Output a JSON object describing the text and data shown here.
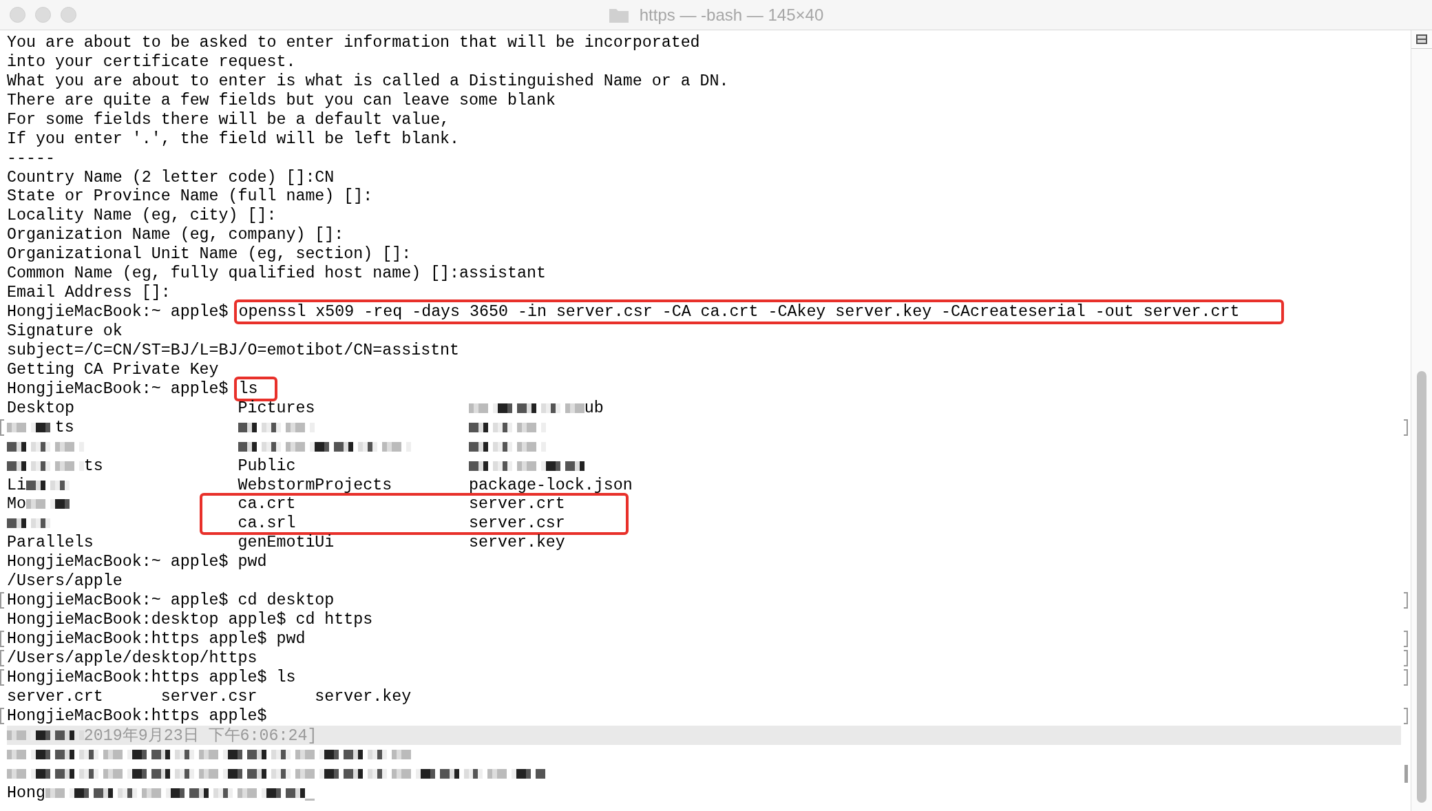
{
  "window": {
    "title": "https — -bash — 145×40"
  },
  "lines": [
    {
      "kind": "text",
      "bookmarked": false,
      "flagged": false,
      "segments": [
        {
          "kind": "text",
          "text": "You are about to be asked to enter information that will be incorporated"
        }
      ]
    },
    {
      "kind": "text",
      "bookmarked": false,
      "flagged": false,
      "segments": [
        {
          "kind": "text",
          "text": "into your certificate request."
        }
      ]
    },
    {
      "kind": "text",
      "bookmarked": false,
      "flagged": false,
      "segments": [
        {
          "kind": "text",
          "text": "What you are about to enter is what is called a Distinguished Name or a DN."
        }
      ]
    },
    {
      "kind": "text",
      "bookmarked": false,
      "flagged": false,
      "segments": [
        {
          "kind": "text",
          "text": "There are quite a few fields but you can leave some blank"
        }
      ]
    },
    {
      "kind": "text",
      "bookmarked": false,
      "flagged": false,
      "segments": [
        {
          "kind": "text",
          "text": "For some fields there will be a default value,"
        }
      ]
    },
    {
      "kind": "text",
      "bookmarked": false,
      "flagged": false,
      "segments": [
        {
          "kind": "text",
          "text": "If you enter '.', the field will be left blank."
        }
      ]
    },
    {
      "kind": "text",
      "bookmarked": false,
      "flagged": false,
      "segments": [
        {
          "kind": "text",
          "text": "-----"
        }
      ]
    },
    {
      "kind": "text",
      "bookmarked": false,
      "flagged": false,
      "segments": [
        {
          "kind": "text",
          "text": "Country Name (2 letter code) []:CN"
        }
      ]
    },
    {
      "kind": "text",
      "bookmarked": false,
      "flagged": false,
      "segments": [
        {
          "kind": "text",
          "text": "State or Province Name (full name) []:"
        }
      ]
    },
    {
      "kind": "text",
      "bookmarked": false,
      "flagged": false,
      "segments": [
        {
          "kind": "text",
          "text": "Locality Name (eg, city) []:"
        }
      ]
    },
    {
      "kind": "text",
      "bookmarked": false,
      "flagged": false,
      "segments": [
        {
          "kind": "text",
          "text": "Organization Name (eg, company) []:"
        }
      ]
    },
    {
      "kind": "text",
      "bookmarked": false,
      "flagged": false,
      "segments": [
        {
          "kind": "text",
          "text": "Organizational Unit Name (eg, section) []:"
        }
      ]
    },
    {
      "kind": "text",
      "bookmarked": false,
      "flagged": false,
      "segments": [
        {
          "kind": "text",
          "text": "Common Name (eg, fully qualified host name) []:assistant"
        }
      ]
    },
    {
      "kind": "text",
      "bookmarked": false,
      "flagged": false,
      "segments": [
        {
          "kind": "text",
          "text": "Email Address []:"
        }
      ]
    },
    {
      "kind": "text",
      "bookmarked": false,
      "flagged": false,
      "segments": [
        {
          "kind": "text",
          "text": "HongjieMacBook:~ apple$ "
        },
        {
          "kind": "boxed",
          "text": "openssl x509 -req -days 3650 -in server.csr -CA ca.crt -CAkey server.key -CAcreateserial -out server.crt"
        }
      ]
    },
    {
      "kind": "text",
      "bookmarked": false,
      "flagged": false,
      "segments": [
        {
          "kind": "text",
          "text": "Signature ok"
        }
      ]
    },
    {
      "kind": "text",
      "bookmarked": false,
      "flagged": false,
      "segments": [
        {
          "kind": "text",
          "text": "subject=/C=CN/ST=BJ/L=BJ/O=emotibot/CN=assistnt"
        }
      ]
    },
    {
      "kind": "text",
      "bookmarked": false,
      "flagged": false,
      "segments": [
        {
          "kind": "text",
          "text": "Getting CA Private Key"
        }
      ]
    },
    {
      "kind": "text",
      "bookmarked": false,
      "flagged": false,
      "segments": [
        {
          "kind": "text",
          "text": "HongjieMacBook:~ apple$ "
        },
        {
          "kind": "boxed",
          "text": "ls"
        }
      ]
    },
    {
      "kind": "listing",
      "bookmarked": false,
      "flagged": false,
      "boxed": false,
      "cells": [
        [
          {
            "kind": "text",
            "text": "Desktop"
          }
        ],
        [
          {
            "kind": "text",
            "text": "Pictures"
          }
        ],
        [
          {
            "kind": "blur-long"
          },
          {
            "kind": "text",
            "text": "ub"
          }
        ]
      ]
    },
    {
      "kind": "listing",
      "bookmarked": true,
      "flagged": false,
      "boxed": false,
      "cells": [
        [
          {
            "kind": "blur-short"
          },
          {
            "kind": "text",
            "text": "ts"
          }
        ],
        [
          {
            "kind": "blur-medium"
          }
        ],
        [
          {
            "kind": "blur-medium"
          }
        ]
      ]
    },
    {
      "kind": "listing",
      "bookmarked": false,
      "flagged": false,
      "boxed": false,
      "cells": [
        [
          {
            "kind": "blur-medium"
          }
        ],
        [
          {
            "kind": "blur-xlong"
          }
        ],
        [
          {
            "kind": "blur-medium"
          }
        ]
      ]
    },
    {
      "kind": "listing",
      "bookmarked": false,
      "flagged": false,
      "boxed": false,
      "cells": [
        [
          {
            "kind": "blur-medium"
          },
          {
            "kind": "text",
            "text": "ts"
          }
        ],
        [
          {
            "kind": "text",
            "text": "Public"
          }
        ],
        [
          {
            "kind": "blur-long"
          }
        ]
      ]
    },
    {
      "kind": "listing",
      "bookmarked": false,
      "flagged": false,
      "boxed": false,
      "cells": [
        [
          {
            "kind": "text",
            "text": "Li"
          },
          {
            "kind": "blur-short"
          }
        ],
        [
          {
            "kind": "text",
            "text": "WebstormProjects"
          }
        ],
        [
          {
            "kind": "text",
            "text": "package-lock.json"
          }
        ]
      ]
    },
    {
      "kind": "listing",
      "bookmarked": false,
      "flagged": false,
      "boxed": true,
      "cells": [
        [
          {
            "kind": "text",
            "text": "Mo"
          },
          {
            "kind": "blur-short"
          }
        ],
        [
          {
            "kind": "text",
            "text": "ca.crt"
          }
        ],
        [
          {
            "kind": "text",
            "text": "server.crt"
          }
        ]
      ]
    },
    {
      "kind": "listing",
      "bookmarked": false,
      "flagged": false,
      "boxed": true,
      "cells": [
        [
          {
            "kind": "blur-short"
          }
        ],
        [
          {
            "kind": "text",
            "text": "ca.srl"
          }
        ],
        [
          {
            "kind": "text",
            "text": "server.csr"
          }
        ]
      ]
    },
    {
      "kind": "listing",
      "bookmarked": false,
      "flagged": false,
      "boxed": false,
      "cells": [
        [
          {
            "kind": "text",
            "text": "Parallels"
          }
        ],
        [
          {
            "kind": "text",
            "text": "genEmotiUi"
          }
        ],
        [
          {
            "kind": "text",
            "text": "server.key"
          }
        ]
      ]
    },
    {
      "kind": "text",
      "bookmarked": false,
      "flagged": false,
      "segments": [
        {
          "kind": "text",
          "text": "HongjieMacBook:~ apple$ pwd"
        }
      ]
    },
    {
      "kind": "text",
      "bookmarked": false,
      "flagged": false,
      "segments": [
        {
          "kind": "text",
          "text": "/Users/apple"
        }
      ]
    },
    {
      "kind": "text",
      "bookmarked": true,
      "flagged": false,
      "segments": [
        {
          "kind": "text",
          "text": "HongjieMacBook:~ apple$ cd desktop"
        }
      ]
    },
    {
      "kind": "text",
      "bookmarked": false,
      "flagged": false,
      "segments": [
        {
          "kind": "text",
          "text": "HongjieMacBook:desktop apple$ cd https"
        }
      ]
    },
    {
      "kind": "text",
      "bookmarked": true,
      "flagged": false,
      "segments": [
        {
          "kind": "text",
          "text": "HongjieMacBook:https apple$ pwd"
        }
      ]
    },
    {
      "kind": "text",
      "bookmarked": true,
      "flagged": false,
      "segments": [
        {
          "kind": "text",
          "text": "/Users/apple/desktop/https"
        }
      ]
    },
    {
      "kind": "text",
      "bookmarked": true,
      "flagged": false,
      "segments": [
        {
          "kind": "text",
          "text": "HongjieMacBook:https apple$ ls"
        }
      ]
    },
    {
      "kind": "text",
      "bookmarked": false,
      "flagged": false,
      "segments": [
        {
          "kind": "text",
          "text": "server.crt      server.csr      server.key"
        }
      ]
    },
    {
      "kind": "text",
      "bookmarked": true,
      "flagged": false,
      "segments": [
        {
          "kind": "text",
          "text": "HongjieMacBook:https apple$"
        }
      ]
    },
    {
      "kind": "banner",
      "bookmarked": false,
      "flagged": false,
      "segments": [
        {
          "kind": "blur-medium"
        },
        {
          "kind": "text",
          "text": "2019年9月23日 下午6:06:24]"
        }
      ]
    },
    {
      "kind": "text",
      "bookmarked": false,
      "flagged": false,
      "segments": [
        {
          "kind": "blur-line"
        }
      ]
    },
    {
      "kind": "text",
      "bookmarked": false,
      "flagged": true,
      "segments": [
        {
          "kind": "blur-wide"
        }
      ]
    },
    {
      "kind": "text",
      "bookmarked": false,
      "flagged": false,
      "segments": [
        {
          "kind": "text",
          "text": "Hong"
        },
        {
          "kind": "blur-tail"
        },
        {
          "kind": "cursor"
        }
      ]
    }
  ]
}
